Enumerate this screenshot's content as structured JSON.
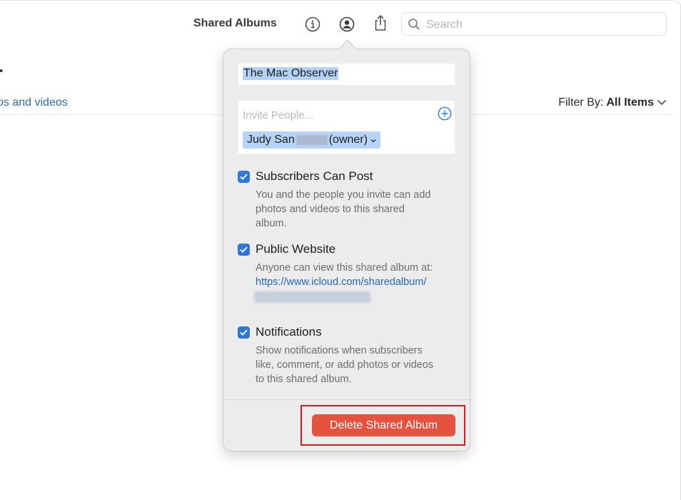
{
  "toolbar": {
    "title": "Shared Albums",
    "icons": [
      "info-icon",
      "person-circle-icon",
      "share-icon"
    ],
    "search_placeholder": "Search"
  },
  "page": {
    "title_fragment": "r",
    "subtitle_fragment": "os and videos",
    "filter_label": "Filter By:",
    "filter_value": "All Items"
  },
  "popover": {
    "album_name": "The Mac Observer",
    "invite_placeholder": "Invite People...",
    "owner_name_start": "Judy San",
    "owner_suffix": "(owner)",
    "options": [
      {
        "label": "Subscribers Can Post",
        "checked": true,
        "description": [
          "You and the people you invite can add",
          "photos and videos to this shared",
          "album."
        ]
      },
      {
        "label": "Public Website",
        "checked": true,
        "description": [
          "Anyone can view this shared album at:"
        ],
        "link": "https://www.icloud.com/sharedalbum/"
      },
      {
        "label": "Notifications",
        "checked": true,
        "description": [
          "Show notifications when subscribers",
          "like, comment, or add photos or videos",
          "to this shared album."
        ]
      }
    ],
    "delete_label": "Delete Shared Album"
  },
  "colors": {
    "accent": "#2f78d7",
    "link": "#2567b8",
    "delete": "#e5533f",
    "highlight_border": "#d11f1f"
  }
}
